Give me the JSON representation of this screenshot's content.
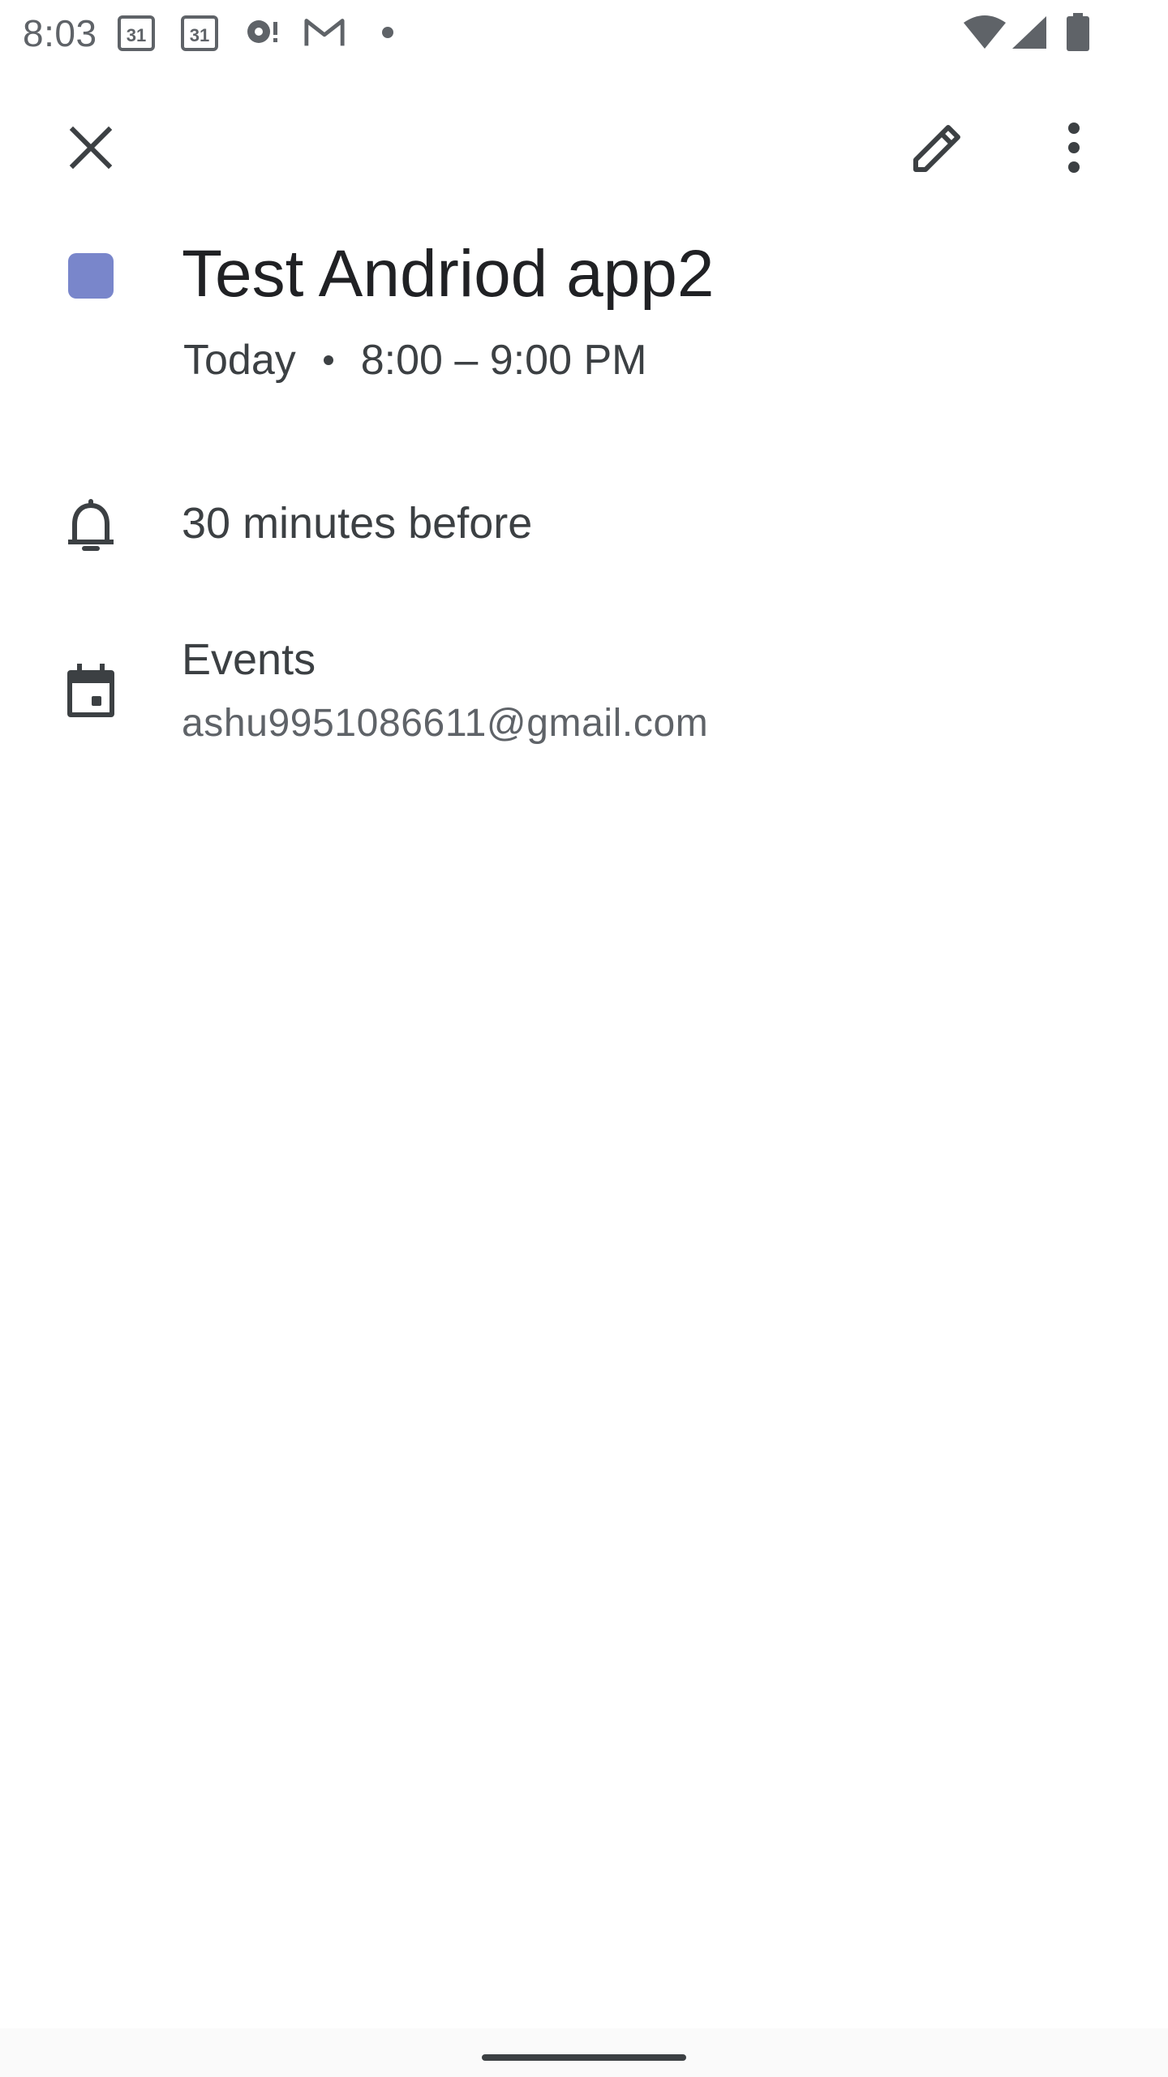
{
  "status_bar": {
    "time": "8:03",
    "calendar_badge_1": "31",
    "calendar_badge_2": "31",
    "icons": [
      "calendar-icon",
      "calendar-icon",
      "assistant-icon",
      "gmail-icon",
      "dot-icon",
      "wifi-icon",
      "signal-icon",
      "battery-icon"
    ]
  },
  "toolbar": {
    "close_icon": "close-icon",
    "edit_icon": "pencil-icon",
    "more_icon": "more-vert-icon"
  },
  "event": {
    "color": "#7986cb",
    "title": "Test Andriod app2",
    "day": "Today",
    "time_range": "8:00 – 9:00 PM"
  },
  "reminder": {
    "icon": "bell-icon",
    "label": "30 minutes before"
  },
  "calendar": {
    "icon": "calendar-event-icon",
    "name": "Events",
    "account": "ashu9951086611@gmail.com"
  },
  "colors": {
    "text_primary": "#202124",
    "text_secondary": "#5f6368",
    "icon": "#3c4043"
  }
}
